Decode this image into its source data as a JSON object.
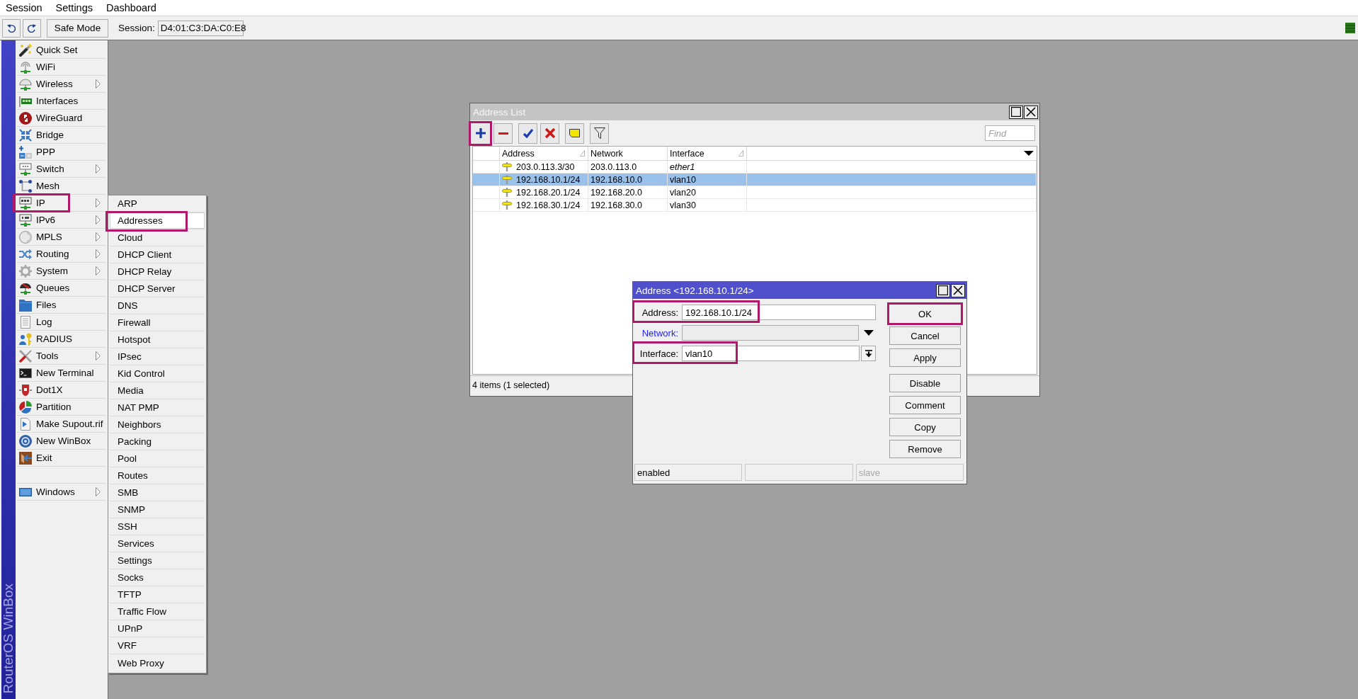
{
  "menu_bar": {
    "items": [
      "Session",
      "Settings",
      "Dashboard"
    ]
  },
  "toolbar": {
    "safe_mode": "Safe Mode",
    "session_label": "Session:",
    "session_value": "D4:01:C3:DA:C0:E8"
  },
  "sidebar": {
    "brand": "RouterOS WinBox",
    "items": [
      {
        "kind": "item",
        "label": "Quick Set",
        "has_submenu": false,
        "highlighted": false
      },
      {
        "kind": "item",
        "label": "WiFi",
        "has_submenu": false,
        "highlighted": false
      },
      {
        "kind": "item",
        "label": "Wireless",
        "has_submenu": true,
        "highlighted": false
      },
      {
        "kind": "item",
        "label": "Interfaces",
        "has_submenu": false,
        "highlighted": false
      },
      {
        "kind": "item",
        "label": "WireGuard",
        "has_submenu": false,
        "highlighted": false
      },
      {
        "kind": "item",
        "label": "Bridge",
        "has_submenu": false,
        "highlighted": false
      },
      {
        "kind": "item",
        "label": "PPP",
        "has_submenu": false,
        "highlighted": false
      },
      {
        "kind": "item",
        "label": "Switch",
        "has_submenu": true,
        "highlighted": false
      },
      {
        "kind": "item",
        "label": "Mesh",
        "has_submenu": false,
        "highlighted": false
      },
      {
        "kind": "item",
        "label": "IP",
        "has_submenu": true,
        "highlighted": true
      },
      {
        "kind": "item",
        "label": "IPv6",
        "has_submenu": true,
        "highlighted": false
      },
      {
        "kind": "item",
        "label": "MPLS",
        "has_submenu": true,
        "highlighted": false
      },
      {
        "kind": "item",
        "label": "Routing",
        "has_submenu": true,
        "highlighted": false
      },
      {
        "kind": "item",
        "label": "System",
        "has_submenu": true,
        "highlighted": false
      },
      {
        "kind": "item",
        "label": "Queues",
        "has_submenu": false,
        "highlighted": false
      },
      {
        "kind": "item",
        "label": "Files",
        "has_submenu": false,
        "highlighted": false
      },
      {
        "kind": "item",
        "label": "Log",
        "has_submenu": false,
        "highlighted": false
      },
      {
        "kind": "item",
        "label": "RADIUS",
        "has_submenu": false,
        "highlighted": false
      },
      {
        "kind": "item",
        "label": "Tools",
        "has_submenu": true,
        "highlighted": false
      },
      {
        "kind": "item",
        "label": "New Terminal",
        "has_submenu": false,
        "highlighted": false
      },
      {
        "kind": "item",
        "label": "Dot1X",
        "has_submenu": false,
        "highlighted": false
      },
      {
        "kind": "item",
        "label": "Partition",
        "has_submenu": false,
        "highlighted": false
      },
      {
        "kind": "item",
        "label": "Make Supout.rif",
        "has_submenu": false,
        "highlighted": false
      },
      {
        "kind": "item",
        "label": "New WinBox",
        "has_submenu": false,
        "highlighted": false
      },
      {
        "kind": "item",
        "label": "Exit",
        "has_submenu": false,
        "highlighted": false
      },
      {
        "kind": "gap"
      },
      {
        "kind": "item",
        "label": "Windows",
        "has_submenu": true,
        "highlighted": false
      }
    ]
  },
  "ip_submenu": {
    "items": [
      {
        "label": "ARP",
        "selected": false,
        "highlighted": false
      },
      {
        "label": "Addresses",
        "selected": true,
        "highlighted": true
      },
      {
        "label": "Cloud",
        "selected": false,
        "highlighted": false
      },
      {
        "label": "DHCP Client",
        "selected": false,
        "highlighted": false
      },
      {
        "label": "DHCP Relay",
        "selected": false,
        "highlighted": false
      },
      {
        "label": "DHCP Server",
        "selected": false,
        "highlighted": false
      },
      {
        "label": "DNS",
        "selected": false,
        "highlighted": false
      },
      {
        "label": "Firewall",
        "selected": false,
        "highlighted": false
      },
      {
        "label": "Hotspot",
        "selected": false,
        "highlighted": false
      },
      {
        "label": "IPsec",
        "selected": false,
        "highlighted": false
      },
      {
        "label": "Kid Control",
        "selected": false,
        "highlighted": false
      },
      {
        "label": "Media",
        "selected": false,
        "highlighted": false
      },
      {
        "label": "NAT PMP",
        "selected": false,
        "highlighted": false
      },
      {
        "label": "Neighbors",
        "selected": false,
        "highlighted": false
      },
      {
        "label": "Packing",
        "selected": false,
        "highlighted": false
      },
      {
        "label": "Pool",
        "selected": false,
        "highlighted": false
      },
      {
        "label": "Routes",
        "selected": false,
        "highlighted": false
      },
      {
        "label": "SMB",
        "selected": false,
        "highlighted": false
      },
      {
        "label": "SNMP",
        "selected": false,
        "highlighted": false
      },
      {
        "label": "SSH",
        "selected": false,
        "highlighted": false
      },
      {
        "label": "Services",
        "selected": false,
        "highlighted": false
      },
      {
        "label": "Settings",
        "selected": false,
        "highlighted": false
      },
      {
        "label": "Socks",
        "selected": false,
        "highlighted": false
      },
      {
        "label": "TFTP",
        "selected": false,
        "highlighted": false
      },
      {
        "label": "Traffic Flow",
        "selected": false,
        "highlighted": false
      },
      {
        "label": "UPnP",
        "selected": false,
        "highlighted": false
      },
      {
        "label": "VRF",
        "selected": false,
        "highlighted": false
      },
      {
        "label": "Web Proxy",
        "selected": false,
        "highlighted": false
      }
    ]
  },
  "address_list": {
    "title": "Address List",
    "toolbar_groups": [
      [
        {
          "kind": "add",
          "highlighted": true
        },
        {
          "kind": "remove",
          "highlighted": false
        }
      ],
      [
        {
          "kind": "enable",
          "highlighted": false
        },
        {
          "kind": "disable",
          "highlighted": false
        }
      ],
      [
        {
          "kind": "comment",
          "highlighted": false
        }
      ],
      [
        {
          "kind": "filter",
          "highlighted": false
        }
      ]
    ],
    "find_placeholder": "Find",
    "columns": [
      {
        "label": "Address",
        "sorted": true
      },
      {
        "label": "Network",
        "sorted": false
      },
      {
        "label": "Interface",
        "sorted": true
      }
    ],
    "rows": [
      {
        "selected": false,
        "cells": [
          {
            "text": "203.0.113.3/30",
            "emphasized": false
          },
          {
            "text": "203.0.113.0",
            "emphasized": false
          },
          {
            "text": "ether1",
            "emphasized": true
          }
        ]
      },
      {
        "selected": true,
        "cells": [
          {
            "text": "192.168.10.1/24",
            "emphasized": false
          },
          {
            "text": "192.168.10.0",
            "emphasized": false
          },
          {
            "text": "vlan10",
            "emphasized": false
          }
        ]
      },
      {
        "selected": false,
        "cells": [
          {
            "text": "192.168.20.1/24",
            "emphasized": false
          },
          {
            "text": "192.168.20.0",
            "emphasized": false
          },
          {
            "text": "vlan20",
            "emphasized": false
          }
        ]
      },
      {
        "selected": false,
        "cells": [
          {
            "text": "192.168.30.1/24",
            "emphasized": false
          },
          {
            "text": "192.168.30.0",
            "emphasized": false
          },
          {
            "text": "vlan30",
            "emphasized": false
          }
        ]
      }
    ],
    "status": "4 items (1 selected)"
  },
  "address_dialog": {
    "title": "Address <192.168.10.1/24>",
    "fields": [
      {
        "kind": "text",
        "label": "Address:",
        "value": "192.168.10.1/24",
        "highlighted": true
      },
      {
        "kind": "optional",
        "label": "Network:",
        "highlighted": false
      },
      {
        "kind": "select",
        "label": "Interface:",
        "value": "vlan10",
        "highlighted": true
      }
    ],
    "button_groups": [
      [
        {
          "label": "OK",
          "highlighted": true
        },
        {
          "label": "Cancel",
          "highlighted": false
        },
        {
          "label": "Apply",
          "highlighted": false
        }
      ],
      [
        {
          "label": "Disable",
          "highlighted": false
        },
        {
          "label": "Comment",
          "highlighted": false
        },
        {
          "label": "Copy",
          "highlighted": false
        },
        {
          "label": "Remove",
          "highlighted": false
        }
      ]
    ],
    "status_cells": [
      {
        "kind": "text",
        "text": "enabled",
        "greyed": false
      },
      {
        "kind": "empty"
      },
      {
        "kind": "text",
        "text": "slave",
        "greyed": true
      }
    ]
  }
}
